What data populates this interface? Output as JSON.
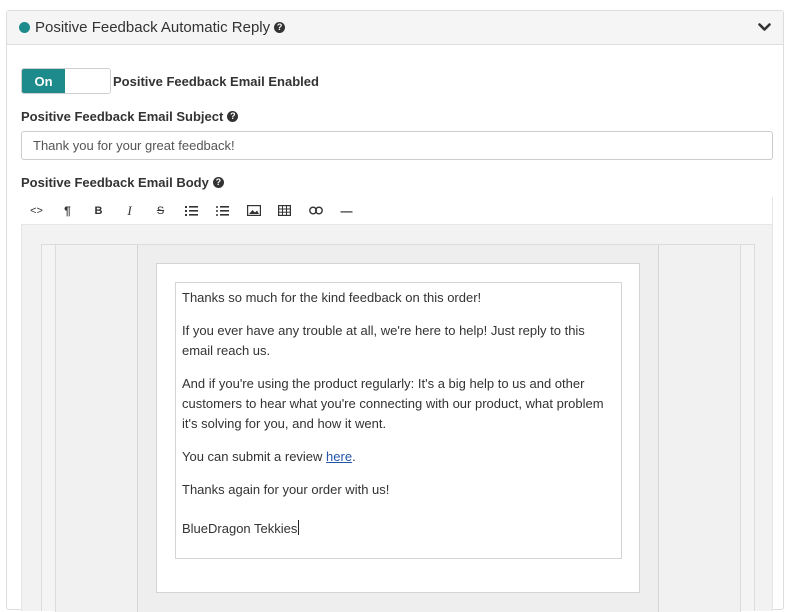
{
  "header": {
    "title": "Positive Feedback Automatic Reply",
    "status_color": "#1d8b8b"
  },
  "toggle": {
    "on_label": "On",
    "label": "Positive Feedback Email Enabled"
  },
  "subject": {
    "label": "Positive Feedback Email Subject",
    "value": "Thank you for your great feedback!"
  },
  "body": {
    "label": "Positive Feedback Email Body",
    "toolbar": [
      "code-view",
      "paragraph",
      "bold",
      "italic",
      "strikethrough",
      "ordered-list",
      "unordered-list",
      "image",
      "table",
      "link",
      "horizontal-rule"
    ],
    "toolbar_glyphs": {
      "code": "<>",
      "paragraph": "¶",
      "bold": "B",
      "italic": "I",
      "strike": "S",
      "hr": "—"
    },
    "paragraphs": [
      "Thanks so much for the kind feedback on this order!",
      "If you ever have any trouble at all, we're here to help! Just reply to this email reach us.",
      "And if you're using the product regularly: It's a big help to us and other customers to hear what you're connecting with our product, what problem it's solving for you, and how it went."
    ],
    "review_prefix": "You can submit a review ",
    "review_link": "here",
    "review_suffix": ".",
    "thanks": "Thanks again for your order with us!",
    "signature": "BlueDragon Tekkies"
  },
  "colors": {
    "accent": "#1d8b8b",
    "link": "#2255aa"
  }
}
